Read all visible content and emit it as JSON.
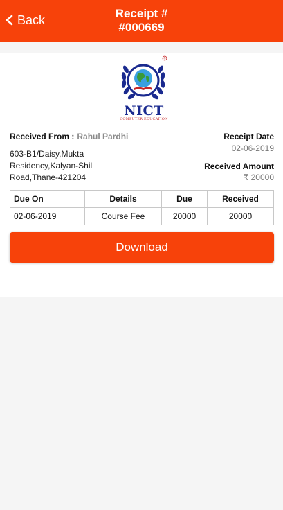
{
  "colors": {
    "primary": "#f7420a",
    "background": "#f5f5f5",
    "card": "#ffffff",
    "muted_text": "#8a8a8a"
  },
  "header": {
    "back_label": "Back",
    "back_icon": "chevron-left-icon",
    "title_line1": "Receipt #",
    "title_line2": "#000669"
  },
  "logo": {
    "wordmark": "NICT",
    "subtitle": "COMPUTER EDUCATION",
    "registered_mark": "®"
  },
  "receipt": {
    "received_from_label": "Received From :",
    "received_from_value": "Rahul Pardhi",
    "address_lines": [
      "603-B1/Daisy,Mukta",
      "Residency,Kalyan-Shil",
      "Road,Thane-421204"
    ],
    "receipt_date_label": "Receipt Date",
    "receipt_date_value": "02-06-2019",
    "received_amount_label": "Received Amount",
    "received_amount_value": "₹ 20000"
  },
  "table": {
    "headers": [
      "Due On",
      "Details",
      "Due",
      "Received"
    ],
    "rows": [
      [
        "02-06-2019",
        "Course Fee",
        "20000",
        "20000"
      ]
    ]
  },
  "actions": {
    "download_label": "Download"
  }
}
